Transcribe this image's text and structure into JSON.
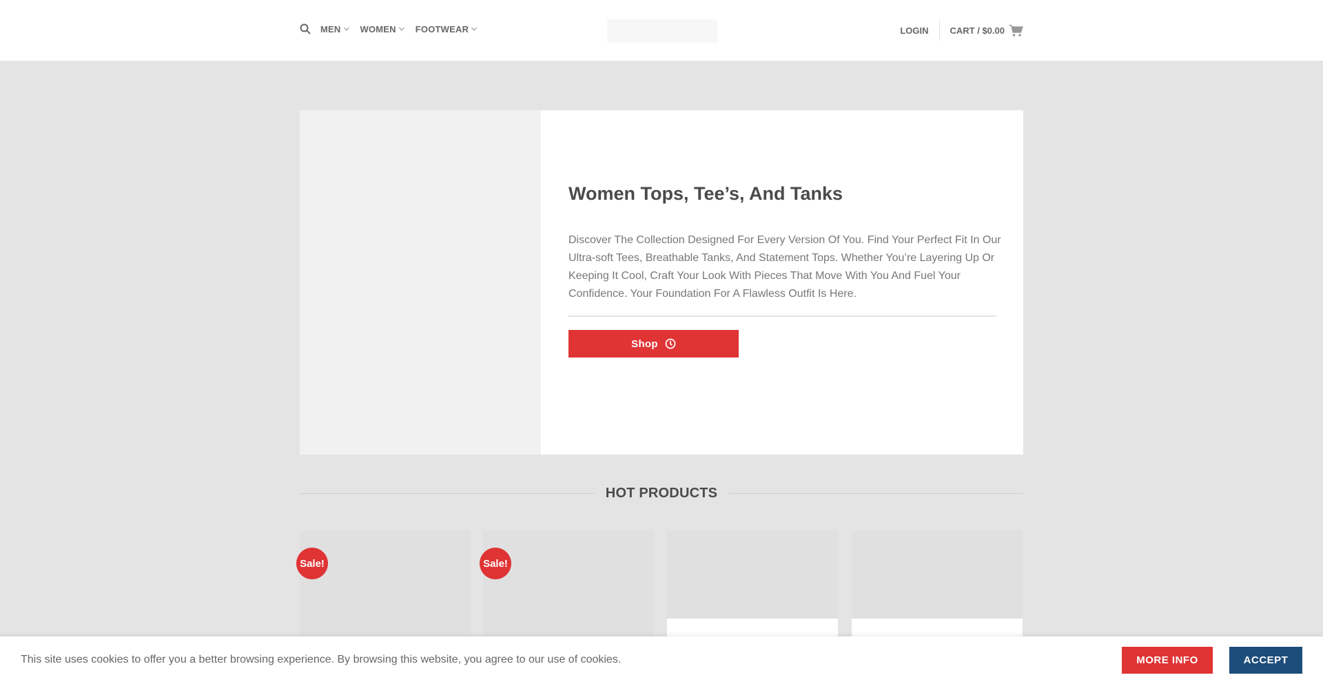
{
  "header": {
    "nav": [
      {
        "label": "MEN",
        "icon": "chevron-down-icon"
      },
      {
        "label": "WOMEN",
        "icon": "chevron-down-icon"
      },
      {
        "label": "FOOTWEAR",
        "icon": "chevron-down-icon"
      }
    ],
    "search_icon": "search-icon",
    "login_label": "LOGIN",
    "cart_label": "CART / $0.00",
    "cart_icon": "shopping-cart-icon"
  },
  "hero": {
    "title": "Women Tops, Tee’s, And Tanks",
    "text": "Discover The Collection Designed For Every Version Of You. Find Your Perfect Fit In Our Ultra-soft Tees, Breathable Tanks, And Statement Tops. Whether You’re Layering Up Or Keeping It Cool, Craft Your Look With Pieces That Move With You And Fuel Your Confidence. Your Foundation For A Flawless Outfit Is Here.",
    "button_label": "Shop",
    "button_icon": "clock-icon"
  },
  "section": {
    "title": "HOT PRODUCTS"
  },
  "products": [
    {
      "badge": "Sale!"
    },
    {
      "badge": "Sale!"
    },
    {
      "badge": ""
    },
    {
      "badge": ""
    }
  ],
  "cookie": {
    "text": "This site uses cookies to offer you a better browsing experience. By browsing this website, you agree to our use of cookies.",
    "more_info_label": "MORE INFO",
    "accept_label": "ACCEPT"
  },
  "colors": {
    "accent_red": "#df3334",
    "accept_blue": "#1d4d7a",
    "page_bg": "#e4e4e4"
  }
}
